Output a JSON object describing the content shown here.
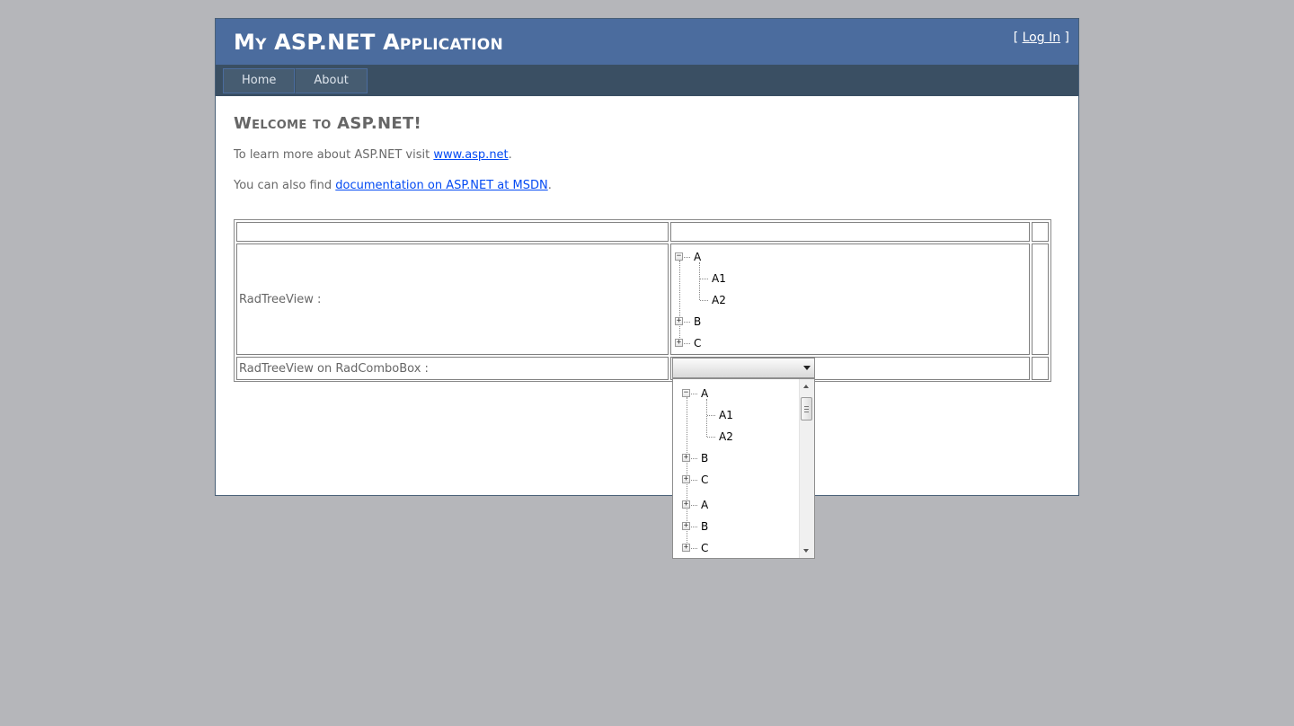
{
  "header": {
    "title": "My ASP.NET Application",
    "login_prefix": "[ ",
    "login_link": "Log In",
    "login_suffix": " ]"
  },
  "menu": {
    "items": [
      {
        "label": "Home"
      },
      {
        "label": "About"
      }
    ]
  },
  "main": {
    "heading": "Welcome to ASP.NET!",
    "para1_text": "To learn more about ASP.NET visit ",
    "para1_link": "www.asp.net",
    "para1_end": ".",
    "para2_text": "You can also find ",
    "para2_link": "documentation on ASP.NET at MSDN",
    "para2_end": "."
  },
  "table": {
    "row2_label": "RadTreeView :",
    "row3_label": "RadTreeView on RadComboBox :"
  },
  "treeview": {
    "nodes": [
      "A",
      "A1",
      "A2",
      "B",
      "C"
    ]
  },
  "combo": {
    "selected": "",
    "tree_nodes": [
      "A",
      "A1",
      "A2",
      "B",
      "C",
      "A",
      "B",
      "C"
    ]
  }
}
